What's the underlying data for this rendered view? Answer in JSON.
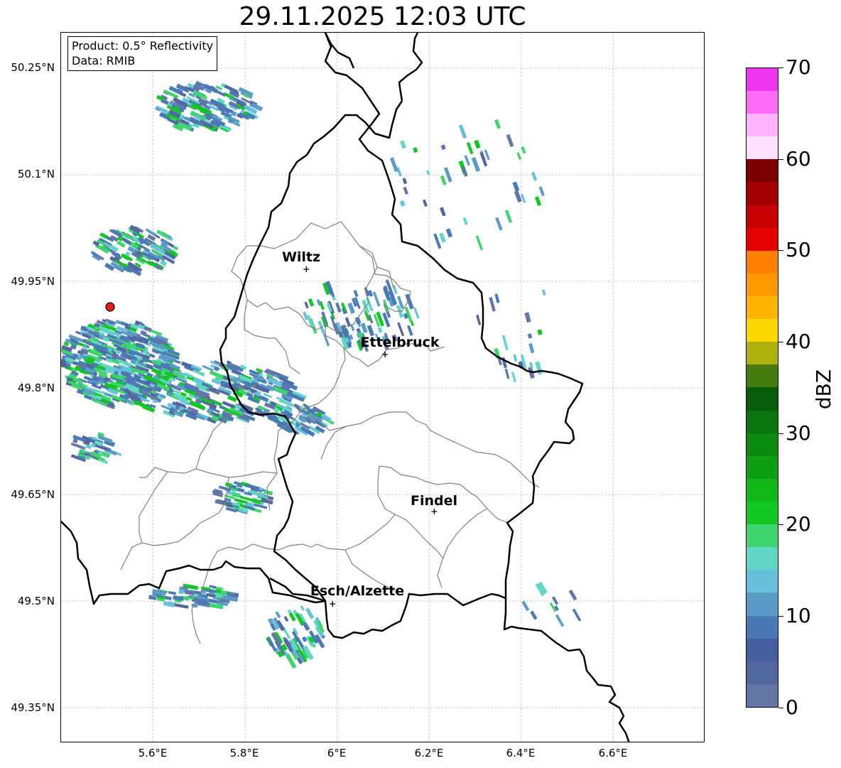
{
  "title": "29.11.2025 12:03 UTC",
  "info": {
    "product": "Product: 0.5° Reflectivity",
    "source": "Data: RMIB"
  },
  "axes": {
    "lat_ticks": [
      "50.25°N",
      "50.1°N",
      "49.95°N",
      "49.8°N",
      "49.65°N",
      "49.5°N",
      "49.35°N"
    ],
    "lon_ticks": [
      "5.6°E",
      "5.8°E",
      "6°E",
      "6.2°E",
      "6.4°E",
      "6.6°E"
    ],
    "lat_range": [
      49.3,
      50.3
    ],
    "lon_range": [
      5.4,
      6.8
    ],
    "gridlines": true
  },
  "cities": [
    {
      "name": "Wiltz",
      "lat": 49.967,
      "lon": 5.933
    },
    {
      "name": "Ettelbruck",
      "lat": 49.847,
      "lon": 6.104
    },
    {
      "name": "Findel",
      "lat": 49.626,
      "lon": 6.211
    },
    {
      "name": "Esch/Alzette",
      "lat": 49.496,
      "lon": 5.99
    }
  ],
  "radar_site": {
    "lat": 49.914,
    "lon": 5.505,
    "color": "#e02020"
  },
  "colorbar": {
    "label": "dBZ",
    "ticks": [
      "0",
      "10",
      "20",
      "30",
      "40",
      "50",
      "60",
      "70"
    ],
    "colors": [
      "#6475a8",
      "#52679e",
      "#435fa0",
      "#4a7ab5",
      "#5a9bc8",
      "#67c0dc",
      "#62d6c4",
      "#3ed46e",
      "#12c722",
      "#11b716",
      "#0f9d12",
      "#0c8a0e",
      "#0a750c",
      "#085c08",
      "#467b0e",
      "#acb10c",
      "#ffd700",
      "#fdb600",
      "#fe9a00",
      "#ff7f00",
      "#e70000",
      "#c50000",
      "#a30000",
      "#7a0000",
      "#ffe1ff",
      "#ffb4ff",
      "#ff6ef9",
      "#ec37ef"
    ]
  },
  "colors": {
    "border_national": "#000000",
    "border_cantonal": "#808080",
    "grid": "#b8b8b8"
  }
}
